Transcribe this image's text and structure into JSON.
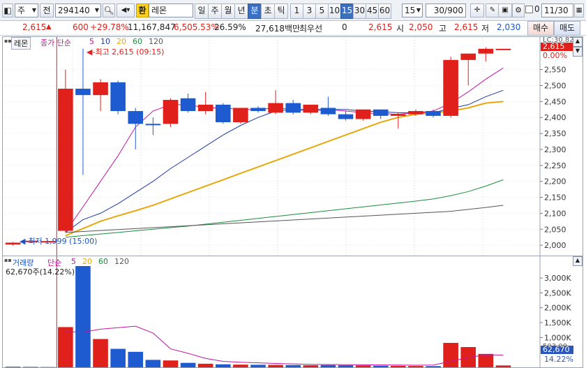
{
  "toolbar": {
    "market": "주",
    "chart_btn": "전",
    "code": "294140",
    "exchange_badge": "환",
    "name": "레몬",
    "periods": [
      "일",
      "주",
      "월",
      "년",
      "분",
      "초",
      "틱"
    ],
    "active_period": "분",
    "intervals": [
      "1",
      "3",
      "5",
      "10",
      "15",
      "30",
      "45",
      "60"
    ],
    "active_interval": "15",
    "interval_select": "15",
    "count": "30/900",
    "date_toggle": "0",
    "date": "11/30"
  },
  "quote": {
    "price": "2,615",
    "change": "600",
    "change_pct": "+29.78%",
    "volume": "11,167,847",
    "volume_pct": "6,505.53%",
    "turnover": "26.59%",
    "amount": "27,618백만",
    "priority_label": "최우선",
    "priority_value": "0",
    "ask": "2,615",
    "open_label": "시",
    "open": "2,050",
    "high_label": "고",
    "high": "2,615",
    "low_label": "저",
    "low": "2,030",
    "buy_label": "매수",
    "sell_label": "매도"
  },
  "price_panel": {
    "name_tag": "레몬",
    "legend_prefix": "종가 단순",
    "legend_ma": [
      "5",
      "10",
      "20",
      "60",
      "120"
    ],
    "ma_colors": [
      "#c3169e",
      "#1c3aa6",
      "#e8a80c",
      "#1b8c3c",
      "#555555"
    ],
    "high_note": "최고 2,615 (09:15)",
    "low_note": "최저 1,999 (15:00)",
    "corner_label": "LC:30.82",
    "current_price_tag": "2,615",
    "zero_pct_tag": "0.00%",
    "y_ticks": [
      "2,550",
      "2,500",
      "2,450",
      "2,400",
      "2,350",
      "2,300",
      "2,250",
      "2,200",
      "2,150",
      "2,100",
      "2,050",
      "2,000"
    ]
  },
  "volume_panel": {
    "legend_title": "거래량",
    "legend_prefix": "단순",
    "legend_ma": [
      "5",
      "20",
      "60",
      "120"
    ],
    "ma_colors": [
      "#c3169e",
      "#e8a80c",
      "#1b8c3c",
      "#555555"
    ],
    "current_volume": "62,670주(14.22%)",
    "y_ticks": [
      "3,000K",
      "2,500K",
      "2,000K",
      "1,500K",
      "1,000K"
    ],
    "value_tag": "62,670",
    "pct_tag": "14.22%",
    "prev_tag": "503,00"
  },
  "chart_data": {
    "type": "candlestick",
    "ylim": [
      1985,
      2630
    ],
    "candles": [
      {
        "o": 2008,
        "h": 2010,
        "l": 1999,
        "c": 2002,
        "up": true
      },
      {
        "o": 2010,
        "h": 2015,
        "l": 2010,
        "c": 2014,
        "up": true
      },
      {
        "o": 2011,
        "h": 2014,
        "l": 2010,
        "c": 2013,
        "up": true
      },
      {
        "o": 2045,
        "h": 2550,
        "l": 2040,
        "c": 2490,
        "up": true
      },
      {
        "o": 2490,
        "h": 2615,
        "l": 2220,
        "c": 2470,
        "up": false
      },
      {
        "o": 2470,
        "h": 2520,
        "l": 2420,
        "c": 2510,
        "up": true
      },
      {
        "o": 2510,
        "h": 2515,
        "l": 2410,
        "c": 2420,
        "up": false
      },
      {
        "o": 2420,
        "h": 2430,
        "l": 2300,
        "c": 2380,
        "up": false
      },
      {
        "o": 2380,
        "h": 2400,
        "l": 2345,
        "c": 2380,
        "up": false
      },
      {
        "o": 2380,
        "h": 2460,
        "l": 2370,
        "c": 2455,
        "up": true
      },
      {
        "o": 2460,
        "h": 2475,
        "l": 2415,
        "c": 2420,
        "up": false
      },
      {
        "o": 2420,
        "h": 2480,
        "l": 2410,
        "c": 2440,
        "up": true
      },
      {
        "o": 2440,
        "h": 2445,
        "l": 2380,
        "c": 2385,
        "up": false
      },
      {
        "o": 2385,
        "h": 2430,
        "l": 2380,
        "c": 2430,
        "up": true
      },
      {
        "o": 2430,
        "h": 2435,
        "l": 2415,
        "c": 2420,
        "up": false
      },
      {
        "o": 2415,
        "h": 2485,
        "l": 2410,
        "c": 2445,
        "up": true
      },
      {
        "o": 2445,
        "h": 2455,
        "l": 2410,
        "c": 2415,
        "up": false
      },
      {
        "o": 2415,
        "h": 2440,
        "l": 2410,
        "c": 2440,
        "up": true
      },
      {
        "o": 2430,
        "h": 2465,
        "l": 2405,
        "c": 2410,
        "up": false
      },
      {
        "o": 2410,
        "h": 2420,
        "l": 2390,
        "c": 2395,
        "up": false
      },
      {
        "o": 2395,
        "h": 2425,
        "l": 2390,
        "c": 2425,
        "up": true
      },
      {
        "o": 2425,
        "h": 2425,
        "l": 2395,
        "c": 2405,
        "up": false
      },
      {
        "o": 2405,
        "h": 2415,
        "l": 2365,
        "c": 2410,
        "up": true
      },
      {
        "o": 2410,
        "h": 2425,
        "l": 2405,
        "c": 2420,
        "up": true
      },
      {
        "o": 2420,
        "h": 2425,
        "l": 2400,
        "c": 2405,
        "up": false
      },
      {
        "o": 2405,
        "h": 2590,
        "l": 2400,
        "c": 2580,
        "up": true
      },
      {
        "o": 2580,
        "h": 2600,
        "l": 2500,
        "c": 2600,
        "up": true
      },
      {
        "o": 2600,
        "h": 2620,
        "l": 2575,
        "c": 2615,
        "up": true
      },
      {
        "o": 2615,
        "h": 2615,
        "l": 2615,
        "c": 2615,
        "up": true
      }
    ],
    "ma_series": [
      {
        "name": "5",
        "values": [
          null,
          null,
          null,
          2042,
          2120,
          2200,
          2280,
          2370,
          2420,
          2440,
          2440,
          2430,
          2430,
          2425,
          2425,
          2430,
          2425,
          2420,
          2425,
          2420,
          2415,
          2412,
          2410,
          2415,
          2420,
          2445,
          2480,
          2520,
          2555
        ]
      },
      {
        "name": "10",
        "values": [
          null,
          null,
          null,
          2040,
          2080,
          2100,
          2130,
          2165,
          2200,
          2240,
          2275,
          2310,
          2345,
          2375,
          2400,
          2420,
          2425,
          2425,
          2425,
          2425,
          2420,
          2418,
          2415,
          2415,
          2415,
          2428,
          2440,
          2465,
          2485
        ]
      },
      {
        "name": "20",
        "values": [
          null,
          null,
          null,
          2030,
          2052,
          2075,
          2092,
          2108,
          2125,
          2145,
          2165,
          2185,
          2205,
          2225,
          2245,
          2265,
          2285,
          2305,
          2325,
          2345,
          2365,
          2385,
          2400,
          2410,
          2415,
          2420,
          2430,
          2445,
          2450
        ]
      },
      {
        "name": "60",
        "values": [
          null,
          null,
          null,
          2025,
          2030,
          2035,
          2040,
          2045,
          2050,
          2055,
          2060,
          2066,
          2072,
          2078,
          2084,
          2090,
          2096,
          2102,
          2108,
          2114,
          2120,
          2126,
          2132,
          2138,
          2145,
          2155,
          2168,
          2185,
          2205
        ]
      },
      {
        "name": "120",
        "values": [
          null,
          null,
          null,
          2040,
          2043,
          2046,
          2049,
          2052,
          2055,
          2058,
          2061,
          2064,
          2067,
          2070,
          2073,
          2076,
          2079,
          2082,
          2085,
          2088,
          2091,
          2094,
          2097,
          2100,
          2103,
          2106,
          2112,
          2118,
          2125
        ]
      }
    ],
    "volume_ylim": [
      0,
      3400000
    ],
    "volumes": [
      20000,
      15000,
      10000,
      1350000,
      3400000,
      950000,
      620000,
      520000,
      250000,
      230000,
      150000,
      120000,
      100000,
      90000,
      85000,
      80000,
      75000,
      70000,
      75000,
      70000,
      65000,
      55000,
      50000,
      45000,
      40000,
      820000,
      680000,
      450000,
      62670
    ],
    "volume_ma5": [
      null,
      null,
      null,
      1200000,
      1180000,
      1280000,
      1330000,
      1380000,
      1150000,
      620000,
      470000,
      300000,
      200000,
      170000,
      150000,
      130000,
      115000,
      100000,
      95000,
      90000,
      85000,
      80000,
      75000,
      70000,
      75000,
      200000,
      330000,
      420000,
      410000
    ]
  }
}
